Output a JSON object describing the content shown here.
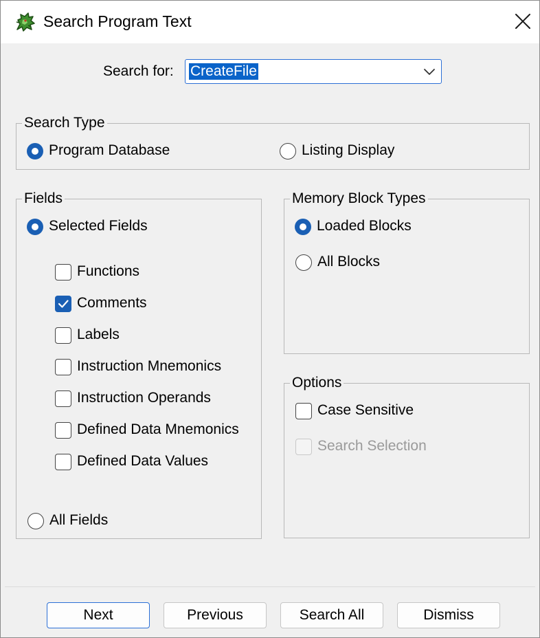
{
  "window": {
    "title": "Search Program Text",
    "icon": "ghidra-dragon-icon",
    "close_icon": "close-icon"
  },
  "search": {
    "label": "Search for:",
    "value": "CreateFile"
  },
  "search_type": {
    "legend": "Search Type",
    "options": [
      {
        "label": "Program Database",
        "checked": true
      },
      {
        "label": "Listing Display",
        "checked": false
      }
    ]
  },
  "fields": {
    "legend": "Fields",
    "selected_fields_label": "Selected Fields",
    "selected_fields_checked": true,
    "checkboxes": [
      {
        "label": "Functions",
        "checked": false
      },
      {
        "label": "Comments",
        "checked": true
      },
      {
        "label": "Labels",
        "checked": false
      },
      {
        "label": "Instruction Mnemonics",
        "checked": false
      },
      {
        "label": "Instruction Operands",
        "checked": false
      },
      {
        "label": "Defined Data Mnemonics",
        "checked": false
      },
      {
        "label": "Defined Data Values",
        "checked": false
      }
    ],
    "all_fields_label": "All Fields",
    "all_fields_checked": false
  },
  "memory_block_types": {
    "legend": "Memory Block Types",
    "options": [
      {
        "label": "Loaded Blocks",
        "checked": true
      },
      {
        "label": "All Blocks",
        "checked": false
      }
    ]
  },
  "options": {
    "legend": "Options",
    "case_sensitive_label": "Case Sensitive",
    "case_sensitive_checked": false,
    "search_selection_label": "Search Selection",
    "search_selection_enabled": false
  },
  "buttons": {
    "next": "Next",
    "previous": "Previous",
    "search_all": "Search All",
    "dismiss": "Dismiss"
  },
  "colors": {
    "accent": "#1a5fb4",
    "selection": "#0a63c9",
    "focus_border": "#2b6fd6",
    "dialog_bg": "#f0f0f0"
  }
}
